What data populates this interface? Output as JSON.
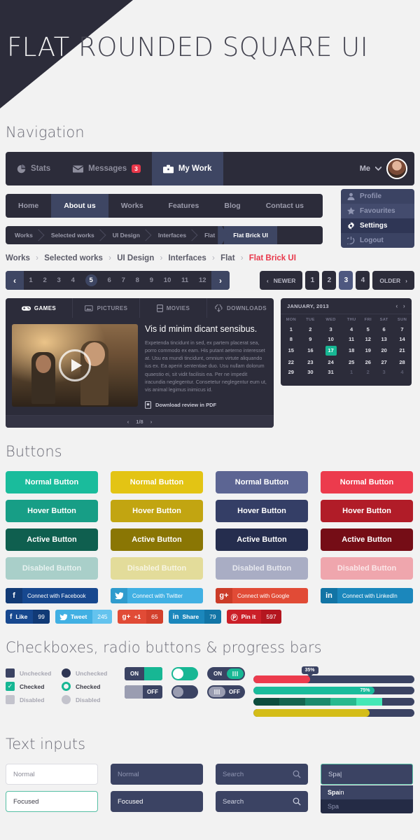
{
  "hero": {
    "title_part1": "FLAT",
    "title_part2": " ROUNDED SQUARE UI"
  },
  "sections": {
    "navigation": "Navigation",
    "buttons": "Buttons",
    "checkboxes": "Checkboxes, radio buttons & progress bars",
    "text_inputs": "Text inputs"
  },
  "topnav": {
    "items": [
      {
        "label": "Stats",
        "icon": "pie-chart-icon",
        "active": false,
        "badge": ""
      },
      {
        "label": "Messages",
        "icon": "envelope-icon",
        "active": false,
        "badge": "3"
      },
      {
        "label": "My Work",
        "icon": "briefcase-icon",
        "active": true,
        "badge": ""
      }
    ],
    "user_label": "Me",
    "chevron": "⌄"
  },
  "menubar": {
    "items": [
      "Home",
      "About us",
      "Works",
      "Features",
      "Blog",
      "Contact us"
    ],
    "active_index": 1
  },
  "dropdown": {
    "items": [
      {
        "label": "Profile",
        "icon": "user-icon"
      },
      {
        "label": "Favourites",
        "icon": "star-icon"
      },
      {
        "label": "Settings",
        "icon": "gear-icon"
      },
      {
        "label": "Logout",
        "icon": "power-icon"
      }
    ],
    "active_index": 2
  },
  "breadcrumb": {
    "segments": [
      "Works",
      "Selected works",
      "UI Design",
      "Interfaces",
      "Flat",
      "Flat Brick UI"
    ],
    "active_index": 5,
    "separator": "›"
  },
  "pagination": {
    "prev_glyph": "‹",
    "next_glyph": "›",
    "pages": [
      "1",
      "2",
      "3",
      "4",
      "5",
      "6",
      "7",
      "8",
      "9",
      "10",
      "11",
      "12"
    ],
    "active_page": "5",
    "newer_label": "NEWER",
    "older_label": "OLDER",
    "short_pages": [
      "1",
      "2",
      "3",
      "4"
    ],
    "short_active": "3"
  },
  "tabs": {
    "items": [
      {
        "label": "GAMES",
        "icon": "gamepad-icon",
        "active": true
      },
      {
        "label": "PICTURES",
        "icon": "photo-icon",
        "active": false
      },
      {
        "label": "MOVIES",
        "icon": "film-icon",
        "active": false
      },
      {
        "label": "DOWNLOADS",
        "icon": "cloud-download-icon",
        "active": false
      }
    ],
    "heading": "Vis id minim dicant sensibus.",
    "body": "Expetenda tincidunt in sed, ex partem placerat sea, porro commodo ex eam. His putant aeterno interesset at. Usu ea mundi tincidunt, omnium virtute aliquando ius ex. Ea aperiri sententiae duo. Usu nullam dolorum quaestio ei, sit vidit facilisis ea. Per ne impedit iracundia neglegentur. Consetetur neglegentur eum ut, vis animal legimus inimicus id.",
    "pdf_link": "Download review in PDF",
    "pager": "1/8",
    "pager_prev": "‹",
    "pager_next": "›"
  },
  "calendar": {
    "title": "JANUARY, 2013",
    "prev": "‹",
    "next": "›",
    "weekdays": [
      "MON",
      "TUE",
      "WED",
      "THU",
      "FRI",
      "SAT",
      "SUN"
    ],
    "weeks": [
      [
        "1",
        "2",
        "3",
        "4",
        "5",
        "6",
        "7"
      ],
      [
        "8",
        "9",
        "10",
        "11",
        "12",
        "13",
        "14"
      ],
      [
        "15",
        "16",
        "17",
        "18",
        "19",
        "20",
        "21"
      ],
      [
        "22",
        "23",
        "24",
        "25",
        "26",
        "27",
        "28"
      ],
      [
        "29",
        "30",
        "31",
        "1",
        "2",
        "3",
        "4"
      ]
    ],
    "selected": "17",
    "trailing_start_week": 4,
    "trailing_start_col": 3
  },
  "buttons": {
    "states": [
      "Normal Button",
      "Hover Button",
      "Active Button",
      "Disabled Button"
    ],
    "colors": {
      "teal": {
        "normal": "#1abc9c",
        "hover": "#179e86",
        "active": "#0f5f4f",
        "disabled": "#a9cfc9"
      },
      "yellow": {
        "normal": "#e3c414",
        "hover": "#c2a511",
        "active": "#8a7604",
        "disabled": "#e3dc9a"
      },
      "slate": {
        "normal": "#5c6593",
        "hover": "#343e66",
        "active": "#252d4e",
        "disabled": "#a9adc4"
      },
      "red": {
        "normal": "#ec3b4d",
        "hover": "#b11c28",
        "active": "#750d16",
        "disabled": "#efa6ad"
      }
    }
  },
  "social": {
    "connect": [
      {
        "label": "Connect with Facebook",
        "icon": "facebook-icon",
        "glyph": "f",
        "bg": "#17488f",
        "icon_bg": "#123a75"
      },
      {
        "label": "Connect with Twitter",
        "icon": "twitter-icon",
        "glyph": "ᵠ",
        "bg": "#41b0e3",
        "icon_bg": "#2f9bcd"
      },
      {
        "label": "Connect with Google",
        "icon": "google-plus-icon",
        "glyph": "g+",
        "bg": "#e14b36",
        "icon_bg": "#cb3c28"
      },
      {
        "label": "Connect with LinkedIn",
        "icon": "linkedin-icon",
        "glyph": "in",
        "bg": "#1b87bc",
        "icon_bg": "#1274a5"
      }
    ],
    "share": [
      {
        "label": "Like",
        "count": "99",
        "icon": "facebook-icon",
        "glyph": "f",
        "bg": "#17488f",
        "ct_bg": "#113a76"
      },
      {
        "label": "Tweet",
        "count": "245",
        "icon": "twitter-icon",
        "glyph": "ᵠ",
        "bg": "#41b0e3",
        "ct_bg": "#64c3ee"
      },
      {
        "label": "+1",
        "count": "65",
        "icon": "google-plus-icon",
        "glyph": "g+",
        "bg": "#e14b36",
        "ct_bg": "#d3402c"
      },
      {
        "label": "Share",
        "count": "79",
        "icon": "linkedin-icon",
        "glyph": "in",
        "bg": "#1b87bc",
        "ct_bg": "#1275a6"
      },
      {
        "label": "Pin it",
        "count": "597",
        "icon": "pinterest-icon",
        "glyph": "Ⓟ",
        "bg": "#cb1f28",
        "ct_bg": "#b4161f"
      }
    ]
  },
  "controls": {
    "checkbox_labels": [
      "Unchecked",
      "Checked",
      "Disabled"
    ],
    "radio_labels": [
      "Unchecked",
      "Checked",
      "Disabled"
    ],
    "check_glyph": "✓",
    "toggles": [
      {
        "on": "ON",
        "off": "OFF",
        "style": "square"
      },
      {
        "on": "",
        "off": "",
        "style": "pill"
      },
      {
        "on": "ON",
        "off": "OFF",
        "style": "grip"
      }
    ]
  },
  "progress": [
    {
      "value": 35,
      "label": "35%",
      "color": "#ec3b4d",
      "label_mode": "tooltip"
    },
    {
      "value": 75,
      "label": "75%",
      "color": "#1abc9c",
      "label_mode": "inline"
    },
    {
      "value": 80,
      "label": "",
      "color": "segmented",
      "label_mode": "none",
      "segments": [
        "#0d4c3d",
        "#15654f",
        "#1b8a6c",
        "#27b98e",
        "#44e8b6"
      ]
    },
    {
      "value": 72,
      "label": "",
      "color": "#d4bd19",
      "label_mode": "none"
    }
  ],
  "inputs": {
    "row1": [
      {
        "value": "",
        "placeholder": "Normal",
        "variant": "light"
      },
      {
        "value": "",
        "placeholder": "Normal",
        "variant": "dark"
      },
      {
        "value": "",
        "placeholder": "Search",
        "variant": "search",
        "icon": "search-icon"
      }
    ],
    "row2": [
      {
        "value": "Focused",
        "placeholder": "Focused",
        "variant": "light"
      },
      {
        "value": "Focused",
        "placeholder": "Focused",
        "variant": "dark"
      },
      {
        "value": "",
        "placeholder": "Search",
        "variant": "search",
        "icon": "search-icon"
      }
    ],
    "autocomplete": {
      "value": "Spa",
      "caret": "|",
      "options": [
        {
          "prefix": "Spa",
          "rest": "in",
          "highlighted": true
        },
        {
          "prefix": "",
          "rest": "Spa",
          "highlighted": false
        }
      ]
    }
  }
}
